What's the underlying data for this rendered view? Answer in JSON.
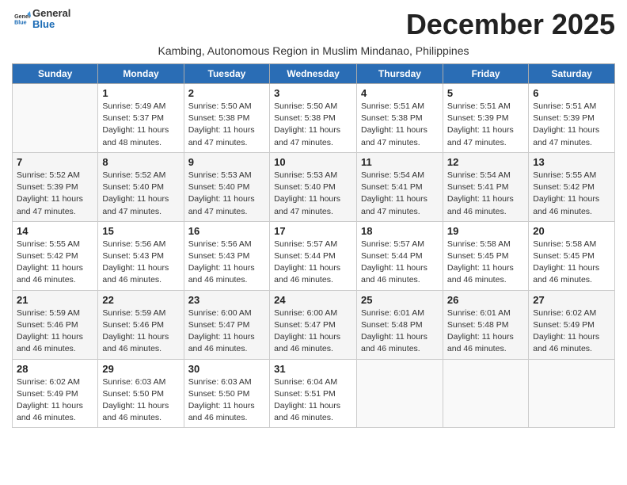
{
  "header": {
    "logo_general": "General",
    "logo_blue": "Blue",
    "month_title": "December 2025",
    "subtitle": "Kambing, Autonomous Region in Muslim Mindanao, Philippines"
  },
  "days_of_week": [
    "Sunday",
    "Monday",
    "Tuesday",
    "Wednesday",
    "Thursday",
    "Friday",
    "Saturday"
  ],
  "weeks": [
    [
      {
        "day": "",
        "info": ""
      },
      {
        "day": "1",
        "info": "Sunrise: 5:49 AM\nSunset: 5:37 PM\nDaylight: 11 hours\nand 48 minutes."
      },
      {
        "day": "2",
        "info": "Sunrise: 5:50 AM\nSunset: 5:38 PM\nDaylight: 11 hours\nand 47 minutes."
      },
      {
        "day": "3",
        "info": "Sunrise: 5:50 AM\nSunset: 5:38 PM\nDaylight: 11 hours\nand 47 minutes."
      },
      {
        "day": "4",
        "info": "Sunrise: 5:51 AM\nSunset: 5:38 PM\nDaylight: 11 hours\nand 47 minutes."
      },
      {
        "day": "5",
        "info": "Sunrise: 5:51 AM\nSunset: 5:39 PM\nDaylight: 11 hours\nand 47 minutes."
      },
      {
        "day": "6",
        "info": "Sunrise: 5:51 AM\nSunset: 5:39 PM\nDaylight: 11 hours\nand 47 minutes."
      }
    ],
    [
      {
        "day": "7",
        "info": "Sunrise: 5:52 AM\nSunset: 5:39 PM\nDaylight: 11 hours\nand 47 minutes."
      },
      {
        "day": "8",
        "info": "Sunrise: 5:52 AM\nSunset: 5:40 PM\nDaylight: 11 hours\nand 47 minutes."
      },
      {
        "day": "9",
        "info": "Sunrise: 5:53 AM\nSunset: 5:40 PM\nDaylight: 11 hours\nand 47 minutes."
      },
      {
        "day": "10",
        "info": "Sunrise: 5:53 AM\nSunset: 5:40 PM\nDaylight: 11 hours\nand 47 minutes."
      },
      {
        "day": "11",
        "info": "Sunrise: 5:54 AM\nSunset: 5:41 PM\nDaylight: 11 hours\nand 47 minutes."
      },
      {
        "day": "12",
        "info": "Sunrise: 5:54 AM\nSunset: 5:41 PM\nDaylight: 11 hours\nand 46 minutes."
      },
      {
        "day": "13",
        "info": "Sunrise: 5:55 AM\nSunset: 5:42 PM\nDaylight: 11 hours\nand 46 minutes."
      }
    ],
    [
      {
        "day": "14",
        "info": "Sunrise: 5:55 AM\nSunset: 5:42 PM\nDaylight: 11 hours\nand 46 minutes."
      },
      {
        "day": "15",
        "info": "Sunrise: 5:56 AM\nSunset: 5:43 PM\nDaylight: 11 hours\nand 46 minutes."
      },
      {
        "day": "16",
        "info": "Sunrise: 5:56 AM\nSunset: 5:43 PM\nDaylight: 11 hours\nand 46 minutes."
      },
      {
        "day": "17",
        "info": "Sunrise: 5:57 AM\nSunset: 5:44 PM\nDaylight: 11 hours\nand 46 minutes."
      },
      {
        "day": "18",
        "info": "Sunrise: 5:57 AM\nSunset: 5:44 PM\nDaylight: 11 hours\nand 46 minutes."
      },
      {
        "day": "19",
        "info": "Sunrise: 5:58 AM\nSunset: 5:45 PM\nDaylight: 11 hours\nand 46 minutes."
      },
      {
        "day": "20",
        "info": "Sunrise: 5:58 AM\nSunset: 5:45 PM\nDaylight: 11 hours\nand 46 minutes."
      }
    ],
    [
      {
        "day": "21",
        "info": "Sunrise: 5:59 AM\nSunset: 5:46 PM\nDaylight: 11 hours\nand 46 minutes."
      },
      {
        "day": "22",
        "info": "Sunrise: 5:59 AM\nSunset: 5:46 PM\nDaylight: 11 hours\nand 46 minutes."
      },
      {
        "day": "23",
        "info": "Sunrise: 6:00 AM\nSunset: 5:47 PM\nDaylight: 11 hours\nand 46 minutes."
      },
      {
        "day": "24",
        "info": "Sunrise: 6:00 AM\nSunset: 5:47 PM\nDaylight: 11 hours\nand 46 minutes."
      },
      {
        "day": "25",
        "info": "Sunrise: 6:01 AM\nSunset: 5:48 PM\nDaylight: 11 hours\nand 46 minutes."
      },
      {
        "day": "26",
        "info": "Sunrise: 6:01 AM\nSunset: 5:48 PM\nDaylight: 11 hours\nand 46 minutes."
      },
      {
        "day": "27",
        "info": "Sunrise: 6:02 AM\nSunset: 5:49 PM\nDaylight: 11 hours\nand 46 minutes."
      }
    ],
    [
      {
        "day": "28",
        "info": "Sunrise: 6:02 AM\nSunset: 5:49 PM\nDaylight: 11 hours\nand 46 minutes."
      },
      {
        "day": "29",
        "info": "Sunrise: 6:03 AM\nSunset: 5:50 PM\nDaylight: 11 hours\nand 46 minutes."
      },
      {
        "day": "30",
        "info": "Sunrise: 6:03 AM\nSunset: 5:50 PM\nDaylight: 11 hours\nand 46 minutes."
      },
      {
        "day": "31",
        "info": "Sunrise: 6:04 AM\nSunset: 5:51 PM\nDaylight: 11 hours\nand 46 minutes."
      },
      {
        "day": "",
        "info": ""
      },
      {
        "day": "",
        "info": ""
      },
      {
        "day": "",
        "info": ""
      }
    ]
  ]
}
